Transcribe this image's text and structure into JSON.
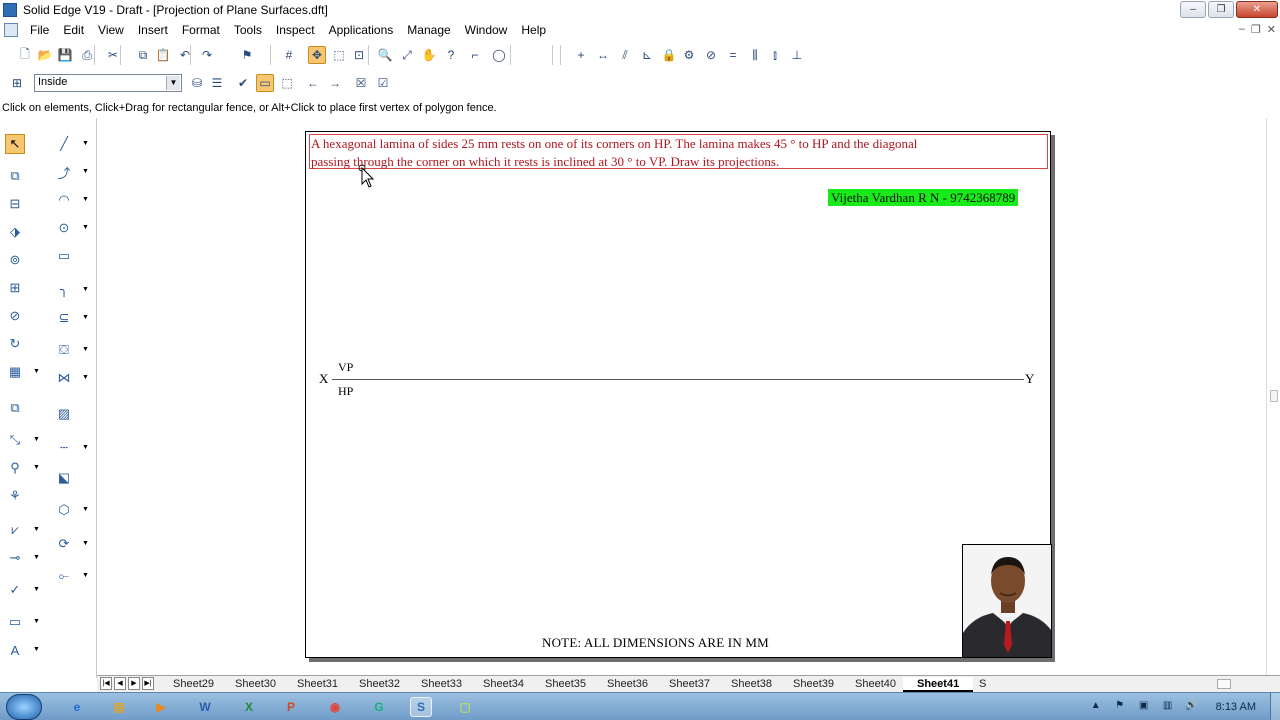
{
  "window": {
    "title": "Solid Edge V19 - Draft - [Projection of Plane Surfaces.dft]",
    "min": "–",
    "max": "❐",
    "close": "✕"
  },
  "menu": [
    "File",
    "Edit",
    "View",
    "Insert",
    "Format",
    "Tools",
    "Inspect",
    "Applications",
    "Manage",
    "Window",
    "Help"
  ],
  "mdi": {
    "min": "–",
    "restore": "❐",
    "close": "✕"
  },
  "toolbar1": {
    "icons": [
      {
        "name": "new-icon",
        "glyph": "🗋"
      },
      {
        "name": "open-icon",
        "glyph": "📂"
      },
      {
        "name": "save-icon",
        "glyph": "💾"
      },
      {
        "name": "print-icon",
        "glyph": "⎙"
      },
      {
        "name": "cut-icon",
        "glyph": "✂"
      },
      {
        "name": "copy-icon",
        "glyph": "⧉"
      },
      {
        "name": "paste-icon",
        "glyph": "📋"
      },
      {
        "name": "undo-icon",
        "glyph": "↶"
      },
      {
        "name": "redo-icon",
        "glyph": "↷"
      },
      {
        "name": "flag-icon",
        "glyph": "⚑"
      },
      {
        "name": "grid-icon",
        "glyph": "#"
      },
      {
        "name": "intellisketch-icon",
        "glyph": "✥"
      },
      {
        "name": "sketch-icon",
        "glyph": "⬚"
      },
      {
        "name": "zoom-area-icon",
        "glyph": "⊡"
      },
      {
        "name": "zoom-icon",
        "glyph": "🔍"
      },
      {
        "name": "fit-icon",
        "glyph": "⤢"
      },
      {
        "name": "pan-icon",
        "glyph": "✋"
      },
      {
        "name": "help-icon",
        "glyph": "?"
      },
      {
        "name": "corner-icon",
        "glyph": "⌐"
      },
      {
        "name": "circle-icon",
        "glyph": "◯"
      },
      {
        "name": "plus-icon",
        "glyph": "+"
      },
      {
        "name": "horizontal-icon",
        "glyph": "↔"
      },
      {
        "name": "parallel-icon",
        "glyph": "⫽"
      },
      {
        "name": "perpendicular-icon",
        "glyph": "⊾"
      },
      {
        "name": "lock-icon",
        "glyph": "🔒"
      },
      {
        "name": "connect-icon",
        "glyph": "⚙"
      },
      {
        "name": "tangent-icon",
        "glyph": "⊘"
      },
      {
        "name": "equal-icon",
        "glyph": "="
      },
      {
        "name": "symmetric-icon",
        "glyph": "⫼"
      },
      {
        "name": "symmetry-axis-icon",
        "glyph": "⫾"
      },
      {
        "name": "relation-handles-icon",
        "glyph": "⊥"
      }
    ]
  },
  "toolbar2": {
    "select_value": "Inside",
    "icons": [
      {
        "name": "select-tool-icon",
        "glyph": "⊞"
      },
      {
        "name": "filter-icon",
        "glyph": "⛁"
      },
      {
        "name": "filter-list-icon",
        "glyph": "☰"
      },
      {
        "name": "accept-icon",
        "glyph": "✔"
      },
      {
        "name": "fence-icon",
        "glyph": "▭"
      },
      {
        "name": "fence-dotted-icon",
        "glyph": "⬚"
      },
      {
        "name": "back-icon",
        "glyph": "←"
      },
      {
        "name": "forward-icon",
        "glyph": "→"
      },
      {
        "name": "deselect-icon",
        "glyph": "☒"
      },
      {
        "name": "finish-icon",
        "glyph": "☑"
      }
    ]
  },
  "prompt": "Click on elements, Click+Drag for rectangular fence, or Alt+Click to place first vertex of polygon fence.",
  "left_tools": [
    {
      "name": "select-arrow-icon",
      "glyph": "↖",
      "col": 0
    },
    {
      "name": "line-icon",
      "glyph": "╱",
      "col": 1
    },
    {
      "name": "view-wizard-icon",
      "glyph": "⧉",
      "col": 0
    },
    {
      "name": "curve-icon",
      "glyph": "⤴",
      "col": 1
    },
    {
      "name": "principal-view-icon",
      "glyph": "⊟",
      "col": 0
    },
    {
      "name": "arc-icon",
      "glyph": "◠",
      "col": 1
    },
    {
      "name": "auxiliary-view-icon",
      "glyph": "⬗",
      "col": 0
    },
    {
      "name": "circle-tool-icon",
      "glyph": "⊙",
      "col": 1
    },
    {
      "name": "detail-view-icon",
      "glyph": "⊚",
      "col": 0
    },
    {
      "name": "rectangle-icon",
      "glyph": "▭",
      "col": 1
    },
    {
      "name": "section-view-icon",
      "glyph": "⊞",
      "col": 0
    },
    {
      "name": "fillet-icon",
      "glyph": "╮",
      "col": 1
    },
    {
      "name": "broken-view-icon",
      "glyph": "⊘",
      "col": 0
    },
    {
      "name": "offset-icon",
      "glyph": "⊆",
      "col": 1
    },
    {
      "name": "update-view-icon",
      "glyph": "↻",
      "col": 0
    },
    {
      "name": "fill-icon",
      "glyph": "⛋",
      "col": 1
    },
    {
      "name": "table-icon",
      "glyph": "▦",
      "col": 0
    },
    {
      "name": "pattern-icon",
      "glyph": "⋈",
      "col": 1
    },
    {
      "name": "layer-icon",
      "glyph": "⧉",
      "col": 0
    },
    {
      "name": "hatch-icon",
      "glyph": "▨",
      "col": 1
    },
    {
      "name": "smart-dimension-icon",
      "glyph": "⤡",
      "col": 0
    },
    {
      "name": "distance-icon",
      "glyph": "┄",
      "col": 1
    },
    {
      "name": "annotation-icon",
      "glyph": "⚲",
      "col": 0
    },
    {
      "name": "callout-icon",
      "glyph": "⬕",
      "col": 1
    },
    {
      "name": "weld-icon",
      "glyph": "⚘",
      "col": 0
    },
    {
      "name": "box-3d-icon",
      "glyph": "⬡",
      "col": 1
    },
    {
      "name": "surface-texture-icon",
      "glyph": "⩗",
      "col": 0
    },
    {
      "name": "rotate-icon",
      "glyph": "⟳",
      "col": 1
    },
    {
      "name": "datum-icon",
      "glyph": "⊸",
      "col": 0
    },
    {
      "name": "connector-icon",
      "glyph": "⟜",
      "col": 1
    },
    {
      "name": "check-mark-icon",
      "glyph": "✓",
      "col": 0
    },
    {
      "name": "frame-icon",
      "glyph": "▭",
      "col": 0
    },
    {
      "name": "text-icon",
      "glyph": "A",
      "col": 0
    }
  ],
  "drawing": {
    "problem_line1": "A hexagonal lamina of sides 25 mm rests on one of its corners on HP. The lamina makes 45 ° to HP and the diagonal",
    "problem_line2": "passing through the corner on which it rests is inclined at 30 ° to VP. Draw its projections.",
    "author": "Vijetha Vardhan R N - 9742368789",
    "x_label": "X",
    "y_label": "Y",
    "vp_label": "VP",
    "hp_label": "HP",
    "note": "NOTE: ALL DIMENSIONS ARE IN MM"
  },
  "sheets": [
    "Sheet29",
    "Sheet30",
    "Sheet31",
    "Sheet32",
    "Sheet33",
    "Sheet34",
    "Sheet35",
    "Sheet36",
    "Sheet37",
    "Sheet38",
    "Sheet39",
    "Sheet40",
    "Sheet41",
    "S"
  ],
  "active_sheet": "Sheet41",
  "taskbar": {
    "apps": [
      {
        "name": "ie-icon",
        "glyph": "e",
        "color": "#1e6fd1"
      },
      {
        "name": "explorer-icon",
        "glyph": "▤",
        "color": "#d9a62b"
      },
      {
        "name": "media-player-icon",
        "glyph": "▶",
        "color": "#e58a1f"
      },
      {
        "name": "word-icon",
        "glyph": "W",
        "color": "#2b5fae"
      },
      {
        "name": "excel-icon",
        "glyph": "X",
        "color": "#1f8a3a"
      },
      {
        "name": "powerpoint-icon",
        "glyph": "P",
        "color": "#d14a24"
      },
      {
        "name": "chrome-icon",
        "glyph": "◉",
        "color": "#e0463a"
      },
      {
        "name": "grammarly-icon",
        "glyph": "G",
        "color": "#15b27a"
      },
      {
        "name": "solid-edge-icon",
        "glyph": "S",
        "color": "#2f6db5"
      },
      {
        "name": "folder-icon",
        "glyph": "▢",
        "color": "#b8d56b"
      }
    ],
    "clock": "8:13 AM"
  }
}
